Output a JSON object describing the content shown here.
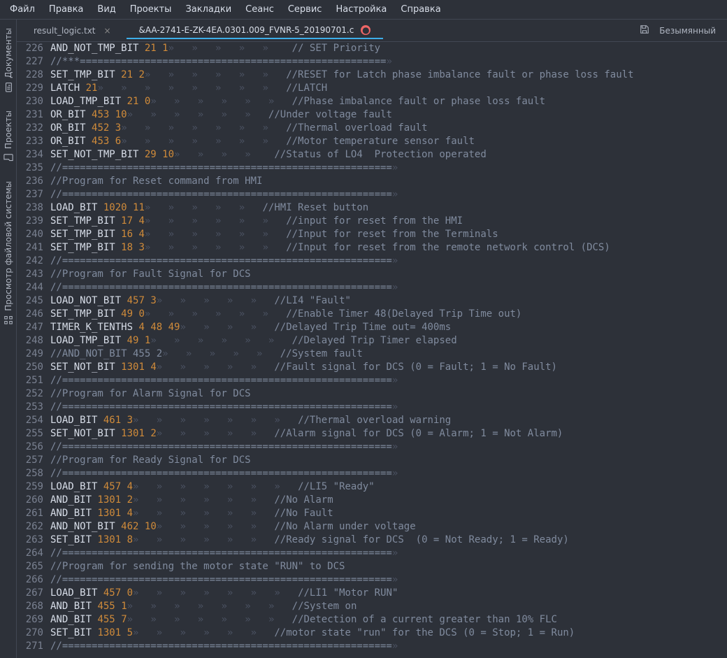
{
  "menu": [
    "Файл",
    "Правка",
    "Вид",
    "Проекты",
    "Закладки",
    "Сеанс",
    "Сервис",
    "Настройка",
    "Справка"
  ],
  "sidebar": [
    {
      "label": "Документы",
      "icon": "doc"
    },
    {
      "label": "Проекты",
      "icon": "folder"
    },
    {
      "label": "Просмотр файловой системы",
      "icon": "fs"
    }
  ],
  "tabs": [
    {
      "label": "result_logic.txt",
      "active": false,
      "modified": false
    },
    {
      "label": "&AA-2741-E-ZK-4EA.0301.009_FVNR-5_20190701.c",
      "active": true,
      "modified": true
    }
  ],
  "tabbar_right": "Безымянный",
  "gutter_start": 226,
  "code_lines": [
    {
      "t": "code",
      "kw": "AND_NOT_TMP_BIT",
      "args": [
        "21",
        "1"
      ],
      "tabs": 5,
      "trailing_ws": true,
      "cm": "// SET Priority"
    },
    {
      "t": "div3"
    },
    {
      "t": "code",
      "kw": "SET_TMP_BIT",
      "args": [
        "21",
        "2"
      ],
      "tabs": 6,
      "cm": "//RESET for Latch phase imbalance fault or phase loss fault"
    },
    {
      "t": "code",
      "kw": "LATCH",
      "args": [
        "21"
      ],
      "tabs": 8,
      "cm": "//LATCH"
    },
    {
      "t": "code",
      "kw": "LOAD_TMP_BIT",
      "args": [
        "21",
        "0"
      ],
      "tabs": 6,
      "cm": "//Phase imbalance fault or phase loss fault"
    },
    {
      "t": "code",
      "kw": "OR_BIT",
      "args": [
        "453",
        "10"
      ],
      "tabs": 6,
      "cm": "//Under voltage fault"
    },
    {
      "t": "code",
      "kw": "OR_BIT",
      "args": [
        "452",
        "3"
      ],
      "tabs": 7,
      "cm": "//Thermal overload fault"
    },
    {
      "t": "code",
      "kw": "OR_BIT",
      "args": [
        "453",
        "6"
      ],
      "tabs": 7,
      "cm": "//Motor temperature sensor fault"
    },
    {
      "t": "code",
      "kw": "SET_NOT_TMP_BIT",
      "args": [
        "29",
        "10"
      ],
      "tabs": 4,
      "trailing_ws": true,
      "cm": "//Status of LO4  Protection operated"
    },
    {
      "t": "div"
    },
    {
      "t": "cm",
      "text": "//Program for Reset command from HMI"
    },
    {
      "t": "div"
    },
    {
      "t": "code",
      "kw": "LOAD_BIT",
      "args": [
        "1020",
        "11"
      ],
      "tabs": 5,
      "cm": "//HMI Reset button"
    },
    {
      "t": "code",
      "kw": "SET_TMP_BIT",
      "args": [
        "17",
        "4"
      ],
      "tabs": 6,
      "cm": "//input for reset from the HMI"
    },
    {
      "t": "code",
      "kw": "SET_TMP_BIT",
      "args": [
        "16",
        "4"
      ],
      "tabs": 6,
      "cm": "//Input for reset from the Terminals"
    },
    {
      "t": "code",
      "kw": "SET_TMP_BIT",
      "args": [
        "18",
        "3"
      ],
      "tabs": 6,
      "cm": "//Input for reset from the remote network control (DCS)"
    },
    {
      "t": "div"
    },
    {
      "t": "cm",
      "text": "//Program for Fault Signal for DCS"
    },
    {
      "t": "div"
    },
    {
      "t": "code",
      "kw": "LOAD_NOT_BIT",
      "args": [
        "457",
        "3"
      ],
      "tabs": 5,
      "cm": "//LI4 \"Fault\""
    },
    {
      "t": "code",
      "kw": "SET_TMP_BIT",
      "args": [
        "49",
        "0"
      ],
      "tabs": 6,
      "cm": "//Enable Timer 48(Delayed Trip Time out)"
    },
    {
      "t": "code",
      "kw": "TIMER_K_TENTHS",
      "args": [
        "4",
        "48",
        "49"
      ],
      "tabs": 4,
      "cm": "//Delayed Trip Time out= 400ms"
    },
    {
      "t": "code",
      "kw": "LOAD_TMP_BIT",
      "args": [
        "49",
        "1"
      ],
      "tabs": 6,
      "cm": "//Delayed Trip Timer elapsed"
    },
    {
      "t": "cm2",
      "text": "//AND_NOT_BIT 455 2",
      "tabs": 5,
      "cm": "//System fault"
    },
    {
      "t": "code",
      "kw": "SET_NOT_BIT",
      "args": [
        "1301",
        "4"
      ],
      "tabs": 5,
      "cm": "//Fault signal for DCS (0 = Fault; 1 = No Fault)"
    },
    {
      "t": "div"
    },
    {
      "t": "cm",
      "text": "//Program for Alarm Signal for DCS"
    },
    {
      "t": "div"
    },
    {
      "t": "code",
      "kw": "LOAD_BIT",
      "args": [
        "461",
        "3"
      ],
      "tabs": 7,
      "cm": "//Thermal overload warning"
    },
    {
      "t": "code",
      "kw": "SET_NOT_BIT",
      "args": [
        "1301",
        "2"
      ],
      "tabs": 5,
      "cm": "//Alarm signal for DCS (0 = Alarm; 1 = Not Alarm)"
    },
    {
      "t": "div"
    },
    {
      "t": "cm",
      "text": "//Program for Ready Signal for DCS"
    },
    {
      "t": "div"
    },
    {
      "t": "code",
      "kw": "LOAD_BIT",
      "args": [
        "457",
        "4"
      ],
      "tabs": 7,
      "cm": "//LI5 \"Ready\""
    },
    {
      "t": "code",
      "kw": "AND_BIT",
      "args": [
        "1301",
        "2"
      ],
      "tabs": 6,
      "cm": "//No Alarm"
    },
    {
      "t": "code",
      "kw": "AND_BIT",
      "args": [
        "1301",
        "4"
      ],
      "tabs": 6,
      "cm": "//No Fault"
    },
    {
      "t": "code",
      "kw": "AND_NOT_BIT",
      "args": [
        "462",
        "10"
      ],
      "tabs": 5,
      "cm": "//No Alarm under voltage"
    },
    {
      "t": "code",
      "kw": "SET_BIT",
      "args": [
        "1301",
        "8"
      ],
      "tabs": 6,
      "cm": "//Ready signal for DCS  (0 = Not Ready; 1 = Ready)"
    },
    {
      "t": "div"
    },
    {
      "t": "cm",
      "text": "//Program for sending the motor state \"RUN\" to DCS"
    },
    {
      "t": "div"
    },
    {
      "t": "code",
      "kw": "LOAD_BIT",
      "args": [
        "457",
        "0"
      ],
      "tabs": 7,
      "cm": "//LI1 \"Motor RUN\""
    },
    {
      "t": "code",
      "kw": "AND_BIT",
      "args": [
        "455",
        "1"
      ],
      "tabs": 7,
      "cm": "//System on"
    },
    {
      "t": "code",
      "kw": "AND_BIT",
      "args": [
        "455",
        "7"
      ],
      "tabs": 7,
      "cm": "//Detection of a current greater than 10% FLC"
    },
    {
      "t": "code",
      "kw": "SET_BIT",
      "args": [
        "1301",
        "5"
      ],
      "tabs": 6,
      "cm": "//motor state \"run\" for the DCS (0 = Stop; 1 = Run)"
    },
    {
      "t": "div"
    }
  ]
}
